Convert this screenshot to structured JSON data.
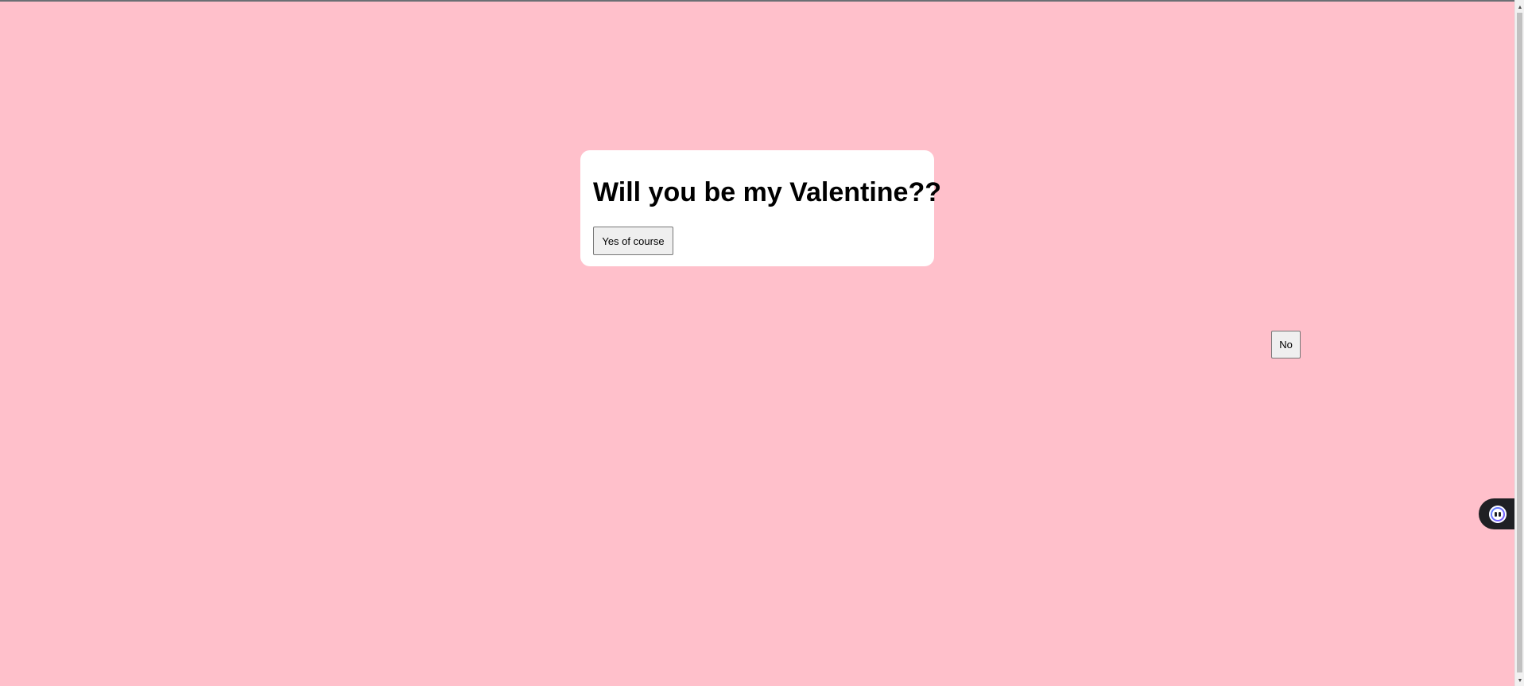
{
  "card": {
    "title": "Will you be my Valentine??",
    "yes_label": "Yes of course"
  },
  "floating": {
    "no_label": "No"
  },
  "colors": {
    "background": "#ffc0cb",
    "card": "#ffffff",
    "widget": "#1f2024"
  },
  "icons": {
    "widget": "assistant-bot-icon",
    "scroll_up": "scroll-up-arrow-icon",
    "scroll_down": "scroll-down-arrow-icon"
  },
  "glyphs": {
    "scroll_up": "▲",
    "scroll_down": "▼"
  }
}
